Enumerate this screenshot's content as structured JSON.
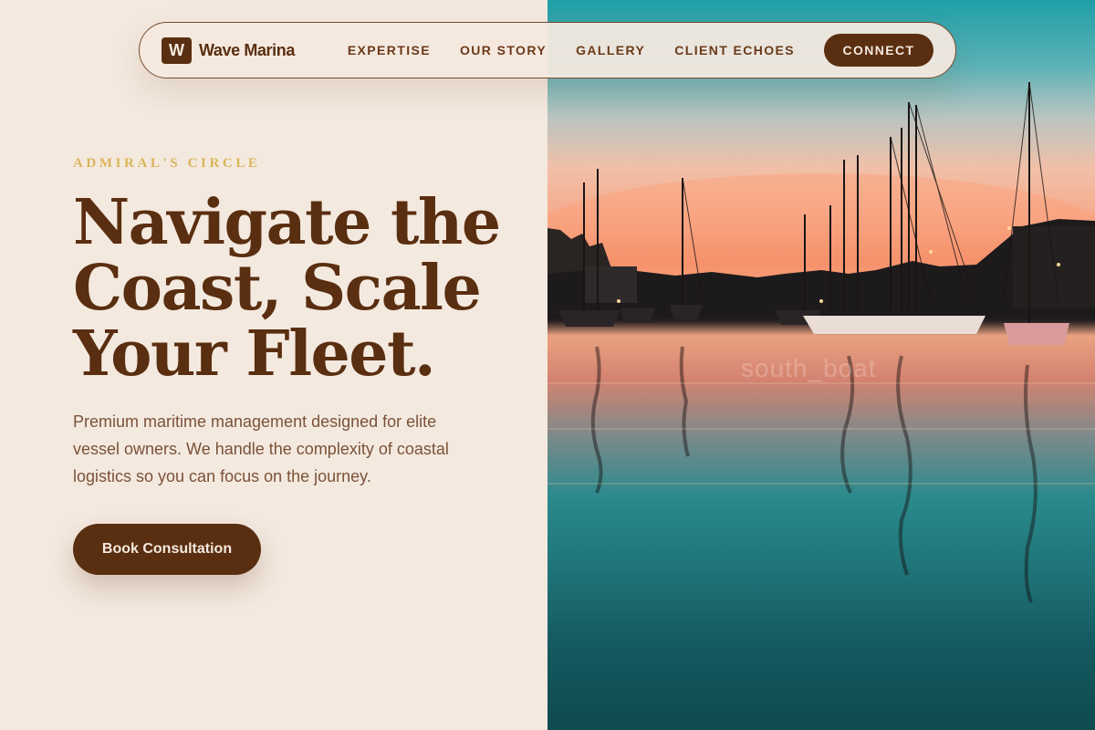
{
  "brand": {
    "mark": "W",
    "name": "Wave Marina"
  },
  "nav": {
    "links": [
      "EXPERTISE",
      "OUR STORY",
      "GALLERY",
      "CLIENT ECHOES"
    ],
    "cta": "CONNECT"
  },
  "hero": {
    "eyebrow": "ADMIRAL'S CIRCLE",
    "headline": "Navigate the Coast, Scale Your Fleet.",
    "lead": "Premium maritime management designed for elite vessel owners. We handle the complexity of coastal logistics so you can focus on the journey.",
    "cta": "Book Consultation"
  },
  "photo": {
    "watermark": "south_boat"
  },
  "colors": {
    "brand_brown": "#5a2e10",
    "background_cream": "#f4e9df",
    "eyebrow_gold": "#d9b45a",
    "body_text": "#7a5238"
  }
}
